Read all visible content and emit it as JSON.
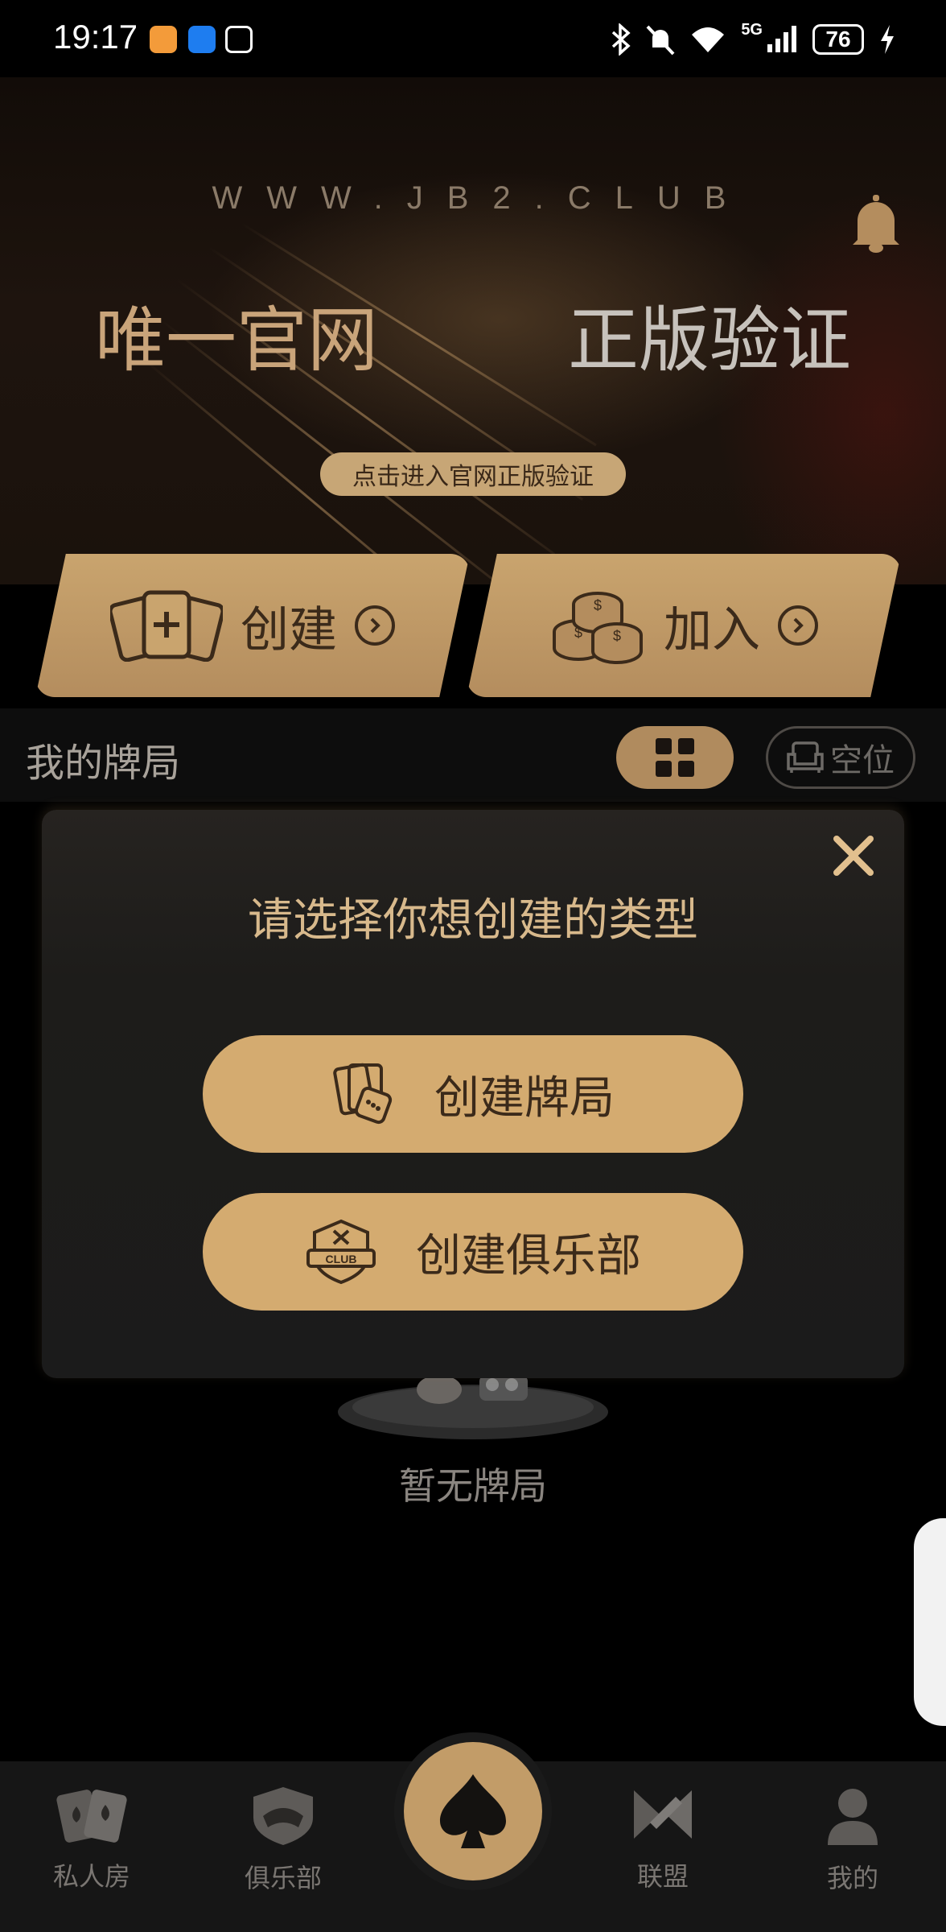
{
  "status_bar": {
    "time": "19:17",
    "network": "5G",
    "battery": "76",
    "icons": [
      "bluetooth-icon",
      "mute-icon",
      "wifi-icon",
      "signal-icon",
      "charging-icon"
    ]
  },
  "banner": {
    "url": "WWW.JB2.CLUB",
    "left_title": "唯一官网",
    "right_title": "正版验证",
    "verify_button": "点击进入官网正版验证",
    "notification_icon": "bell-icon"
  },
  "actions": {
    "create_label": "创建",
    "join_label": "加入"
  },
  "my_games": {
    "title": "我的牌局",
    "vacant_label": "空位",
    "empty_text": "暂无牌局"
  },
  "modal": {
    "title": "请选择你想创建的类型",
    "create_game_label": "创建牌局",
    "create_club_label": "创建俱乐部",
    "club_badge_text": "CLUB"
  },
  "bottom_nav": {
    "items": [
      {
        "label": "私人房",
        "icon": "cards-icon"
      },
      {
        "label": "俱乐部",
        "icon": "club-shield-icon"
      },
      {
        "label": "",
        "icon": "spade-icon"
      },
      {
        "label": "联盟",
        "icon": "alliance-icon"
      },
      {
        "label": "我的",
        "icon": "profile-icon"
      }
    ]
  },
  "colors": {
    "gold": "#c9a46e",
    "gold_dark_text": "#3b2a1a",
    "modal_bg": "#1d1c1a",
    "nav_bg": "#161616"
  }
}
